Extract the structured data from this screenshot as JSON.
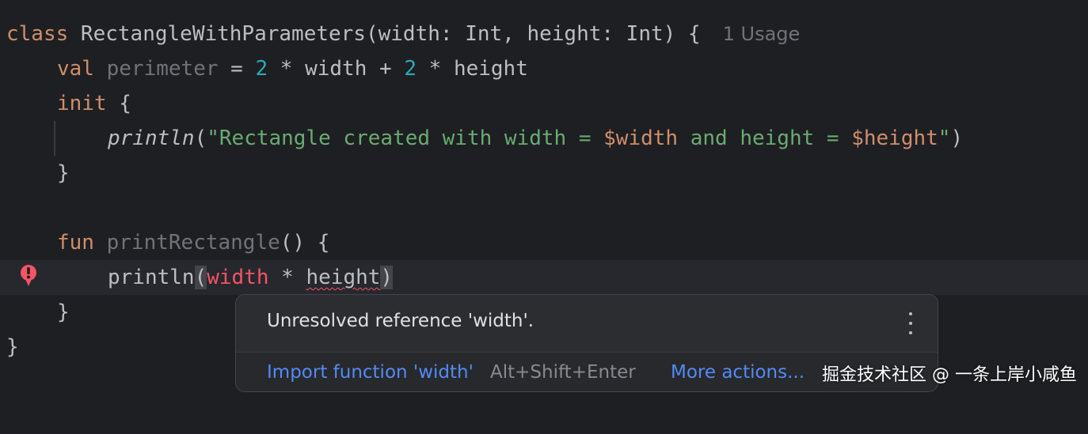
{
  "editor": {
    "line1": {
      "kw_class": "class",
      "rest": " RectangleWithParameters(width: Int, height: Int) {",
      "usage_hint": "1 Usage"
    },
    "line2": {
      "kw_val": "val",
      "prop_name": "perimeter",
      "eq": " = ",
      "num1": "2",
      "mid1": " * width + ",
      "num2": "2",
      "mid2": " * height"
    },
    "line3": {
      "kw_init": "init",
      "brace": " {"
    },
    "line4": {
      "fn": "println",
      "open": "(",
      "str1": "\"Rectangle created with width = ",
      "tmpl1": "$width",
      "str2": " and height = ",
      "tmpl2": "$height",
      "str3": "\"",
      "close": ")"
    },
    "line5": {
      "brace": "}"
    },
    "line7": {
      "kw_fun": "fun",
      "fn_name": "printRectangle",
      "rest": "() {"
    },
    "line8": {
      "fn": "println",
      "open": "(",
      "err_ref": "width",
      "op": " * ",
      "ref2": "height",
      "close": ")"
    },
    "line9": {
      "brace": "}"
    },
    "line10": {
      "brace": "}"
    }
  },
  "gutter": {
    "error_icon": "error-exclamation-icon",
    "error_color": "#f75464"
  },
  "popup": {
    "message": "Unresolved reference 'width'.",
    "more_icon": "vertical-ellipsis-icon",
    "primary_action": "Import function 'width'",
    "primary_shortcut": "Alt+Shift+Enter",
    "more_actions": "More actions..."
  },
  "watermark": {
    "text": "掘金技术社区 @ 一条上岸小咸鱼"
  },
  "colors": {
    "background": "#1e1f22",
    "keyword": "#cf8e6d",
    "number": "#2aacb8",
    "string": "#6aab73",
    "error": "#f75464",
    "link": "#548af7"
  }
}
